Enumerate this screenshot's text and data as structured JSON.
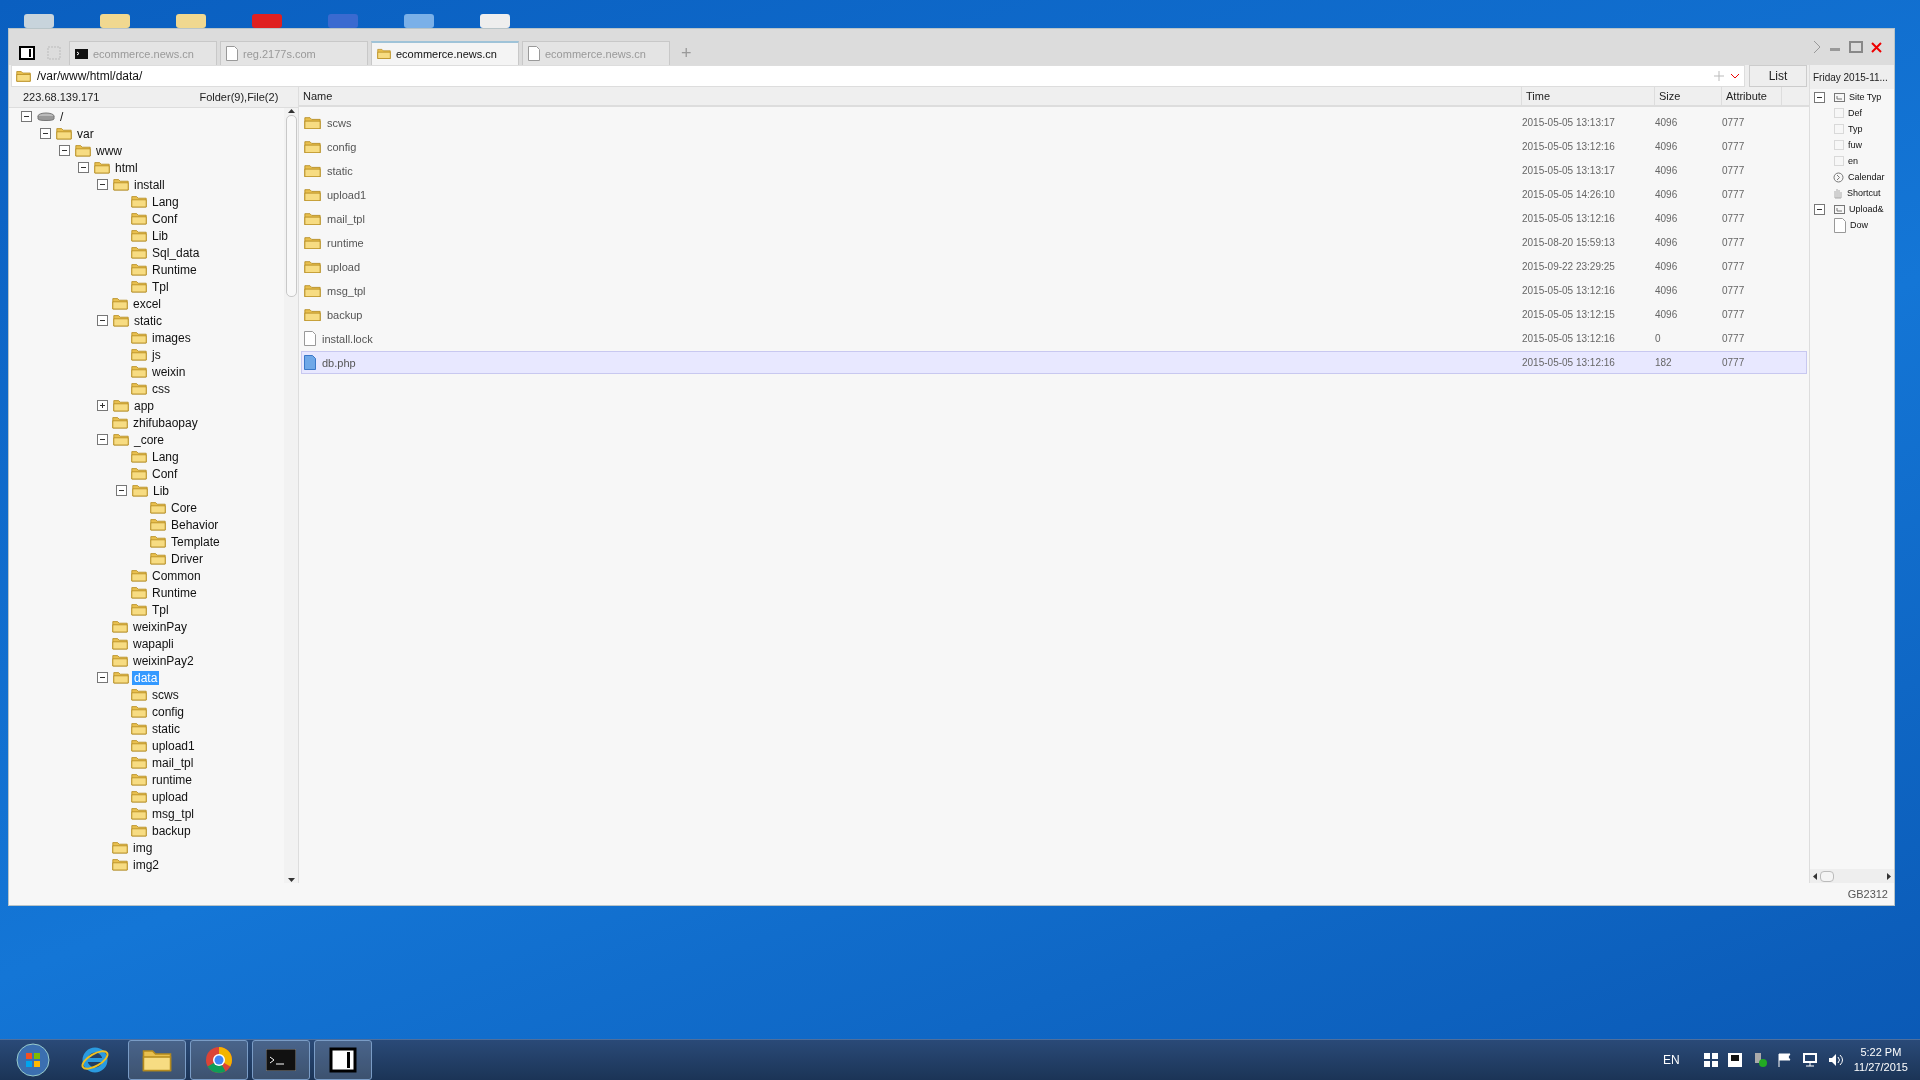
{
  "tabs": [
    {
      "label": "ecommerce.news.cn",
      "kind": "terminal",
      "selected": false
    },
    {
      "label": "reg.2177s.com",
      "kind": "file",
      "selected": false
    },
    {
      "label": "ecommerce.news.cn",
      "kind": "folder",
      "selected": true
    },
    {
      "label": "ecommerce.news.cn",
      "kind": "file",
      "selected": false
    }
  ],
  "new_tab": "+",
  "address": {
    "value": "/var/www/html/data/"
  },
  "view_button": "List",
  "date": "Friday 2015-11...",
  "server": {
    "ip": "223.68.139.171",
    "summary": "Folder(9),File(2)"
  },
  "tree": [
    {
      "label": "/",
      "kind": "drive",
      "selected": false,
      "expanded": true,
      "children": [
        {
          "label": "var",
          "kind": "folder",
          "selected": false,
          "expanded": true,
          "children": [
            {
              "label": "www",
              "kind": "folder",
              "selected": false,
              "expanded": true,
              "children": [
                {
                  "label": "html",
                  "kind": "folder",
                  "selected": false,
                  "expanded": true,
                  "children": [
                    {
                      "label": "install",
                      "kind": "folder",
                      "selected": false,
                      "expanded": true,
                      "children": [
                        {
                          "label": "Lang",
                          "kind": "folder",
                          "selected": false
                        },
                        {
                          "label": "Conf",
                          "kind": "folder",
                          "selected": false
                        },
                        {
                          "label": "Lib",
                          "kind": "folder",
                          "selected": false
                        },
                        {
                          "label": "Sql_data",
                          "kind": "folder",
                          "selected": false
                        },
                        {
                          "label": "Runtime",
                          "kind": "folder",
                          "selected": false
                        },
                        {
                          "label": "Tpl",
                          "kind": "folder",
                          "selected": false
                        }
                      ]
                    },
                    {
                      "label": "excel",
                      "kind": "folder",
                      "selected": false
                    },
                    {
                      "label": "static",
                      "kind": "folder",
                      "selected": false,
                      "expanded": true,
                      "children": [
                        {
                          "label": "images",
                          "kind": "folder",
                          "selected": false
                        },
                        {
                          "label": "js",
                          "kind": "folder",
                          "selected": false
                        },
                        {
                          "label": "weixin",
                          "kind": "folder",
                          "selected": false
                        },
                        {
                          "label": "css",
                          "kind": "folder",
                          "selected": false
                        }
                      ]
                    },
                    {
                      "label": "app",
                      "kind": "folder",
                      "selected": false,
                      "expanded": false
                    },
                    {
                      "label": "zhifubaopay",
                      "kind": "folder",
                      "selected": false
                    },
                    {
                      "label": "_core",
                      "kind": "folder",
                      "selected": false,
                      "expanded": true,
                      "children": [
                        {
                          "label": "Lang",
                          "kind": "folder",
                          "selected": false
                        },
                        {
                          "label": "Conf",
                          "kind": "folder",
                          "selected": false
                        },
                        {
                          "label": "Lib",
                          "kind": "folder",
                          "selected": false,
                          "expanded": true,
                          "children": [
                            {
                              "label": "Core",
                              "kind": "folder",
                              "selected": false
                            },
                            {
                              "label": "Behavior",
                              "kind": "folder",
                              "selected": false
                            },
                            {
                              "label": "Template",
                              "kind": "folder",
                              "selected": false
                            },
                            {
                              "label": "Driver",
                              "kind": "folder",
                              "selected": false
                            }
                          ]
                        },
                        {
                          "label": "Common",
                          "kind": "folder",
                          "selected": false
                        },
                        {
                          "label": "Runtime",
                          "kind": "folder",
                          "selected": false
                        },
                        {
                          "label": "Tpl",
                          "kind": "folder",
                          "selected": false
                        }
                      ]
                    },
                    {
                      "label": "weixinPay",
                      "kind": "folder",
                      "selected": false
                    },
                    {
                      "label": "wapapli",
                      "kind": "folder",
                      "selected": false
                    },
                    {
                      "label": "weixinPay2",
                      "kind": "folder",
                      "selected": false
                    },
                    {
                      "label": "data",
                      "kind": "folder",
                      "selected": true,
                      "expanded": true,
                      "children": [
                        {
                          "label": "scws",
                          "kind": "folder",
                          "selected": false
                        },
                        {
                          "label": "config",
                          "kind": "folder",
                          "selected": false
                        },
                        {
                          "label": "static",
                          "kind": "folder",
                          "selected": false
                        },
                        {
                          "label": "upload1",
                          "kind": "folder",
                          "selected": false
                        },
                        {
                          "label": "mail_tpl",
                          "kind": "folder",
                          "selected": false
                        },
                        {
                          "label": "runtime",
                          "kind": "folder",
                          "selected": false
                        },
                        {
                          "label": "upload",
                          "kind": "folder",
                          "selected": false
                        },
                        {
                          "label": "msg_tpl",
                          "kind": "folder",
                          "selected": false
                        },
                        {
                          "label": "backup",
                          "kind": "folder",
                          "selected": false
                        }
                      ]
                    },
                    {
                      "label": "img",
                      "kind": "folder",
                      "selected": false
                    },
                    {
                      "label": "img2",
                      "kind": "folder",
                      "selected": false
                    }
                  ]
                }
              ]
            }
          ]
        }
      ]
    }
  ],
  "table": {
    "columns": [
      "Name",
      "Time",
      "Size",
      "Attribute"
    ],
    "rows": [
      {
        "kind": "folder",
        "name": "scws",
        "time": "2015-05-05 13:13:17",
        "size": "4096",
        "attribute": "0777",
        "selected": false
      },
      {
        "kind": "folder",
        "name": "config",
        "time": "2015-05-05 13:12:16",
        "size": "4096",
        "attribute": "0777",
        "selected": false
      },
      {
        "kind": "folder",
        "name": "static",
        "time": "2015-05-05 13:13:17",
        "size": "4096",
        "attribute": "0777",
        "selected": false
      },
      {
        "kind": "folder",
        "name": "upload1",
        "time": "2015-05-05 14:26:10",
        "size": "4096",
        "attribute": "0777",
        "selected": false
      },
      {
        "kind": "folder",
        "name": "mail_tpl",
        "time": "2015-05-05 13:12:16",
        "size": "4096",
        "attribute": "0777",
        "selected": false
      },
      {
        "kind": "folder",
        "name": "runtime",
        "time": "2015-08-20 15:59:13",
        "size": "4096",
        "attribute": "0777",
        "selected": false
      },
      {
        "kind": "folder",
        "name": "upload",
        "time": "2015-09-22 23:29:25",
        "size": "4096",
        "attribute": "0777",
        "selected": false
      },
      {
        "kind": "folder",
        "name": "msg_tpl",
        "time": "2015-05-05 13:12:16",
        "size": "4096",
        "attribute": "0777",
        "selected": false
      },
      {
        "kind": "folder",
        "name": "backup",
        "time": "2015-05-05 13:12:15",
        "size": "4096",
        "attribute": "0777",
        "selected": false
      },
      {
        "kind": "file",
        "name": "install.lock",
        "time": "2015-05-05 13:12:16",
        "size": "0",
        "attribute": "0777",
        "selected": false
      },
      {
        "kind": "script",
        "name": "db.php",
        "time": "2015-05-05 13:12:16",
        "size": "182",
        "attribute": "0777",
        "selected": true
      }
    ]
  },
  "side_tree": [
    {
      "label": "Site Typ",
      "kind": "group",
      "expanded": true,
      "children": [
        {
          "label": "Def",
          "kind": "blank"
        },
        {
          "label": "Typ",
          "kind": "blank"
        },
        {
          "label": "fuw",
          "kind": "blank"
        },
        {
          "label": "en",
          "kind": "blank"
        }
      ]
    },
    {
      "label": "Calendar",
      "kind": "calendar"
    },
    {
      "label": "Shortcut",
      "kind": "hand"
    },
    {
      "label": "Upload&",
      "kind": "group",
      "expanded": true,
      "children": [
        {
          "label": "Dow",
          "kind": "file"
        }
      ]
    }
  ],
  "encoding": "GB2312",
  "taskbar": {
    "language": "EN",
    "time": "5:22 PM",
    "date": "11/27/2015"
  }
}
